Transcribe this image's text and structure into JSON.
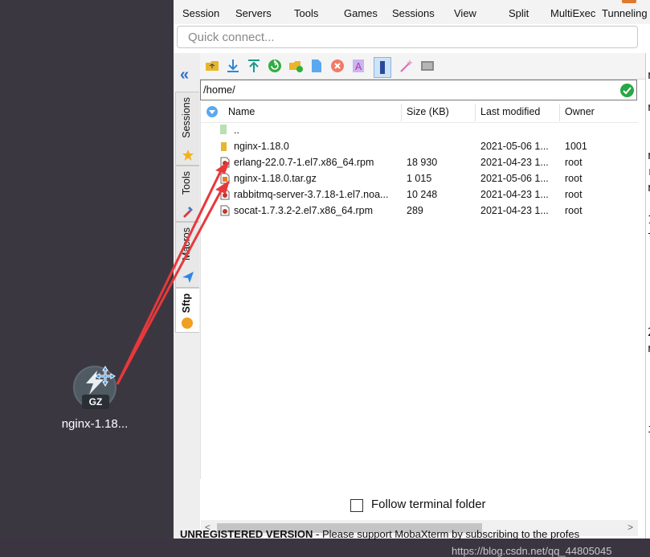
{
  "menu": {
    "items": [
      "Session",
      "Servers",
      "Tools",
      "Games",
      "Sessions",
      "View",
      "Split",
      "MultiExec",
      "Tunneling"
    ]
  },
  "quick_connect": {
    "placeholder": "Quick connect..."
  },
  "sidebar": {
    "tabs": [
      "Sessions",
      "Tools",
      "Macros",
      "Sftp"
    ]
  },
  "sftp": {
    "path": "/home/",
    "columns": [
      "Name",
      "Size (KB)",
      "Last modified",
      "Owner"
    ],
    "rows": [
      {
        "name": "..",
        "size": "",
        "modified": "",
        "owner": "",
        "type": "parent"
      },
      {
        "name": "nginx-1.18.0",
        "size": "",
        "modified": "2021-05-06 1...",
        "owner": "1001",
        "type": "folder"
      },
      {
        "name": "erlang-22.0.7-1.el7.x86_64.rpm",
        "size": "18 930",
        "modified": "2021-04-23 1...",
        "owner": "root",
        "type": "rpm"
      },
      {
        "name": "nginx-1.18.0.tar.gz",
        "size": "1 015",
        "modified": "2021-05-06 1...",
        "owner": "root",
        "type": "gz"
      },
      {
        "name": "rabbitmq-server-3.7.18-1.el7.noa...",
        "size": "10 248",
        "modified": "2021-04-23 1...",
        "owner": "root",
        "type": "rpm"
      },
      {
        "name": "socat-1.7.3.2-2.el7.x86_64.rpm",
        "size": "289",
        "modified": "2021-04-23 1...",
        "owner": "root",
        "type": "rpm"
      }
    ],
    "follow_label": "Follow terminal folder",
    "follow_checked": false
  },
  "desktop": {
    "file_label": "nginx-1.18...",
    "badge_text": "GZ"
  },
  "status": {
    "unregistered": "UNREGISTERED VERSION",
    "message": " -  Please support MobaXterm by subscribing to the profes"
  },
  "watermark": "https://blog.csdn.net/qq_44805045",
  "terminal_chars": [
    "[",
    "n",
    "[",
    "n",
    "[",
    "[",
    "n",
    "r",
    "n",
    "[",
    "1",
    "t",
    "2",
    "n",
    "i",
    "[",
    "["
  ],
  "colors": {
    "arrow": "#e8383b",
    "accent": "#2d6ec9",
    "ok": "#27a745"
  }
}
